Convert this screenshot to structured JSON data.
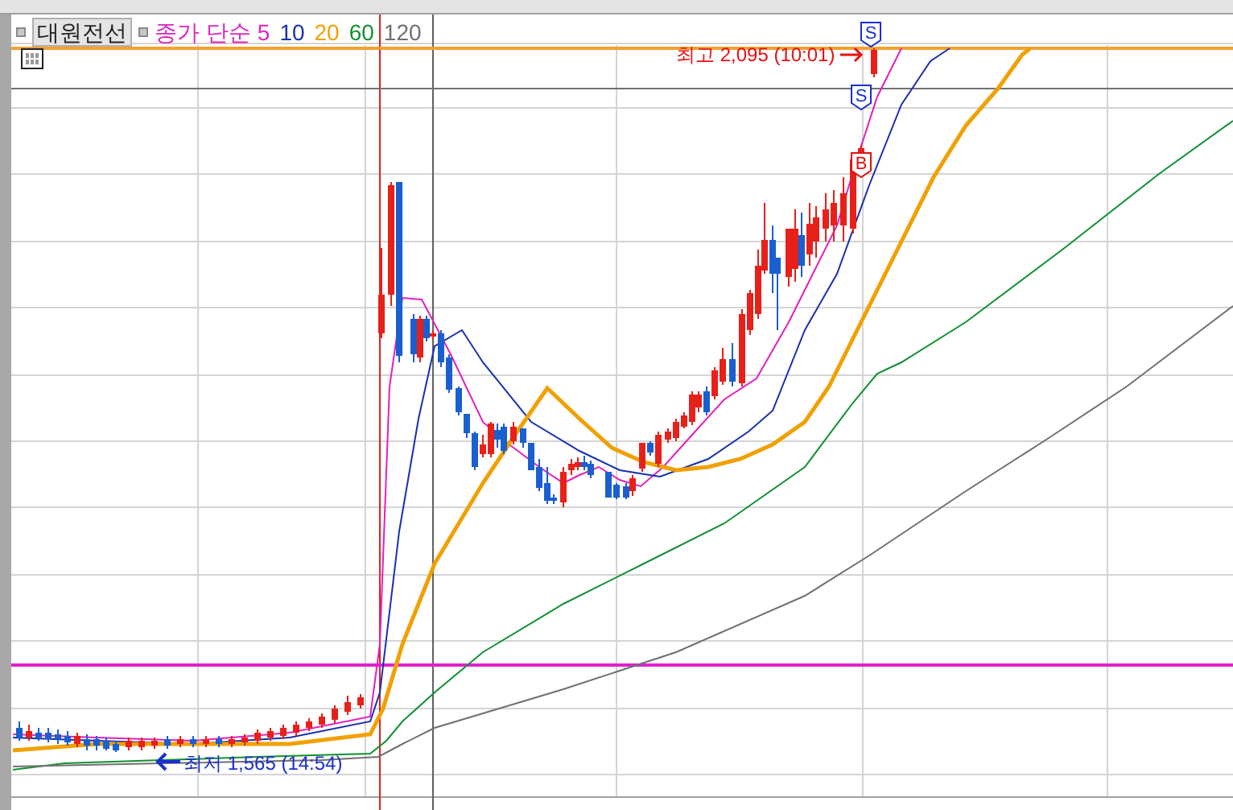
{
  "chart": {
    "title": "대원전선",
    "legend": {
      "label": "종가 단순",
      "periods": [
        {
          "label": "5",
          "color": "#e020c0"
        },
        {
          "label": "10",
          "color": "#1830b0"
        },
        {
          "label": "20",
          "color": "#f0a000"
        },
        {
          "label": "60",
          "color": "#109030"
        },
        {
          "label": "120",
          "color": "#707070"
        }
      ]
    },
    "high_label": "최고 2,095 (10:01)",
    "low_label": "최저 1,565 (14:54)",
    "signals": [
      {
        "label": "S",
        "color": "#1830d0"
      },
      {
        "label": "S",
        "color": "#1830d0"
      },
      {
        "label": "B",
        "color": "#e01010"
      }
    ]
  }
}
